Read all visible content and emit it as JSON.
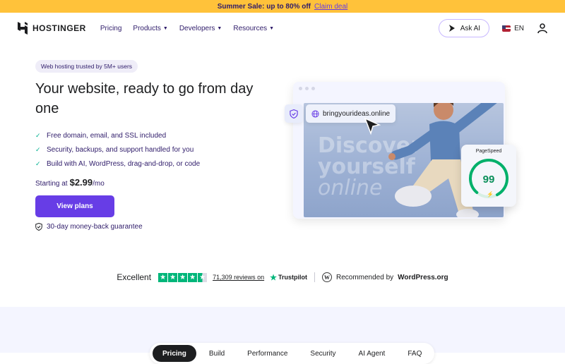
{
  "banner": {
    "text": "Summer Sale: up to 80% off",
    "link": "Claim deal"
  },
  "nav": {
    "logo": "HOSTINGER",
    "items": [
      {
        "label": "Pricing",
        "has_dropdown": false
      },
      {
        "label": "Products",
        "has_dropdown": true
      },
      {
        "label": "Developers",
        "has_dropdown": true
      },
      {
        "label": "Resources",
        "has_dropdown": true
      }
    ],
    "ask_ai": "Ask AI",
    "language": "EN"
  },
  "hero": {
    "pill": "Web hosting trusted by 5M+ users",
    "title": "Your website, ready to go from day one",
    "features": [
      "Free domain, email, and SSL included",
      "Security, backups, and support handled for you",
      "Build with AI, WordPress, drag-and-drop, or code"
    ],
    "price_prefix": "Starting at",
    "price": "$2.99",
    "price_suffix": "/mo",
    "cta": "View plans",
    "guarantee": "30-day money-back guarantee"
  },
  "mockup": {
    "domain": "bringyourideas.online",
    "ghost_lines": [
      "Discover",
      "yourself",
      "online"
    ],
    "pagespeed_label": "PageSpeed",
    "pagespeed_score": "99",
    "pagespeed_fraction": 0.99
  },
  "reviews": {
    "rating_label": "Excellent",
    "review_link": "71,309 reviews on",
    "trustpilot": "Trustpilot",
    "wp_prefix": "Recommended by",
    "wp_brand": "WordPress.org"
  },
  "tabs": [
    "Pricing",
    "Build",
    "Performance",
    "Security",
    "AI Agent",
    "FAQ"
  ],
  "colors": {
    "brand": "#673de6",
    "banner": "#ffc23a",
    "success": "#00b67a"
  }
}
